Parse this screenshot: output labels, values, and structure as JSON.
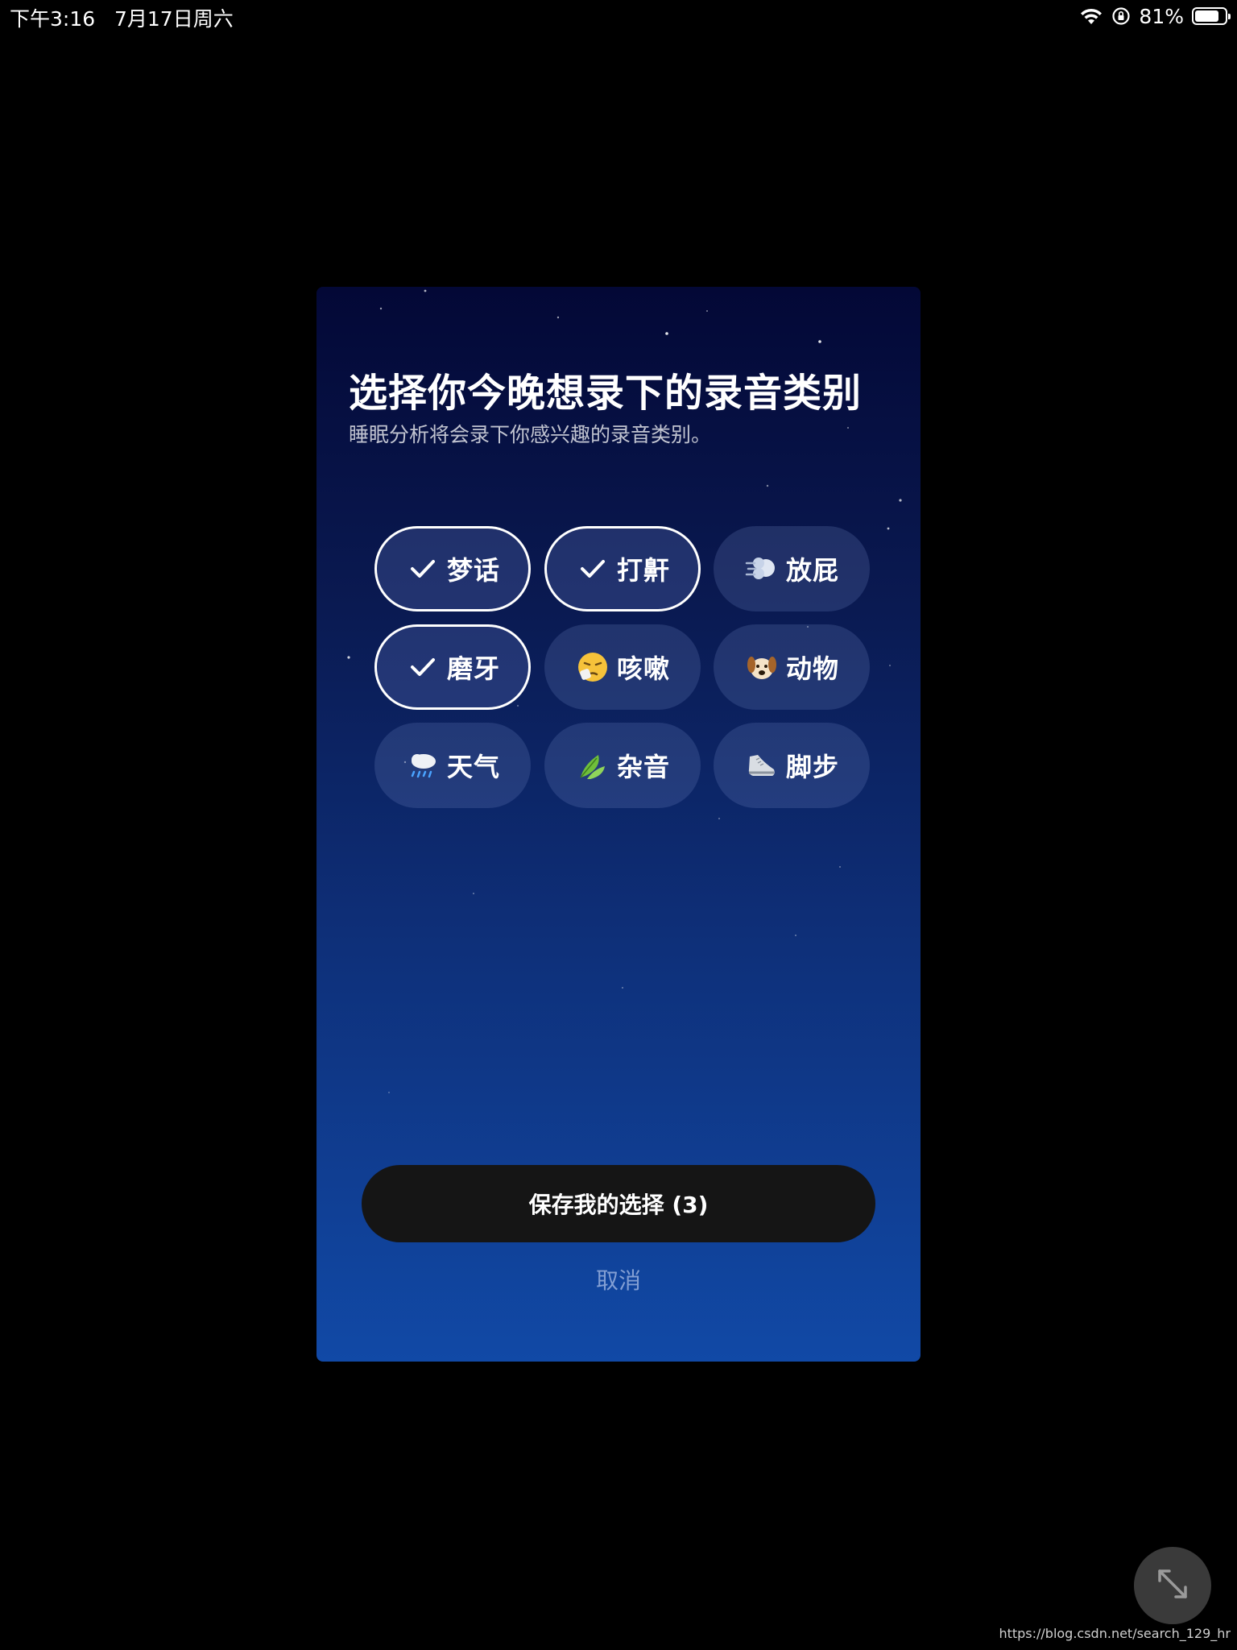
{
  "status_bar": {
    "time_date": "下午3:16   7月17日周六",
    "battery_percent": "81%",
    "battery_level": 0.81,
    "icons": [
      "wifi-icon",
      "rotation-lock-icon",
      "battery-icon"
    ]
  },
  "sheet": {
    "title": "选择你今晚想录下的录音类别",
    "subtitle": "睡眠分析将会录下你感兴趣的录音类别。",
    "categories": [
      {
        "label": "梦话",
        "selected": true,
        "icon": "check-icon"
      },
      {
        "label": "打鼾",
        "selected": true,
        "icon": "check-icon"
      },
      {
        "label": "放屁",
        "selected": false,
        "icon": "wind-puff-icon"
      },
      {
        "label": "磨牙",
        "selected": true,
        "icon": "check-icon"
      },
      {
        "label": "咳嗽",
        "selected": false,
        "icon": "sneezing-face-icon"
      },
      {
        "label": "动物",
        "selected": false,
        "icon": "dog-face-icon"
      },
      {
        "label": "天气",
        "selected": false,
        "icon": "rain-cloud-icon"
      },
      {
        "label": "杂音",
        "selected": false,
        "icon": "leaves-icon"
      },
      {
        "label": "脚步",
        "selected": false,
        "icon": "sneaker-icon"
      }
    ],
    "save_label": "保存我的选择 (3)",
    "cancel_label": "取消"
  },
  "expand_icon": "expand-arrows-icon",
  "watermark": "https://blog.csdn.net/search_129_hr",
  "colors": {
    "background": "#000000",
    "gradient_top": "#030836",
    "gradient_bottom": "#1149a6",
    "save_button": "#151515"
  }
}
